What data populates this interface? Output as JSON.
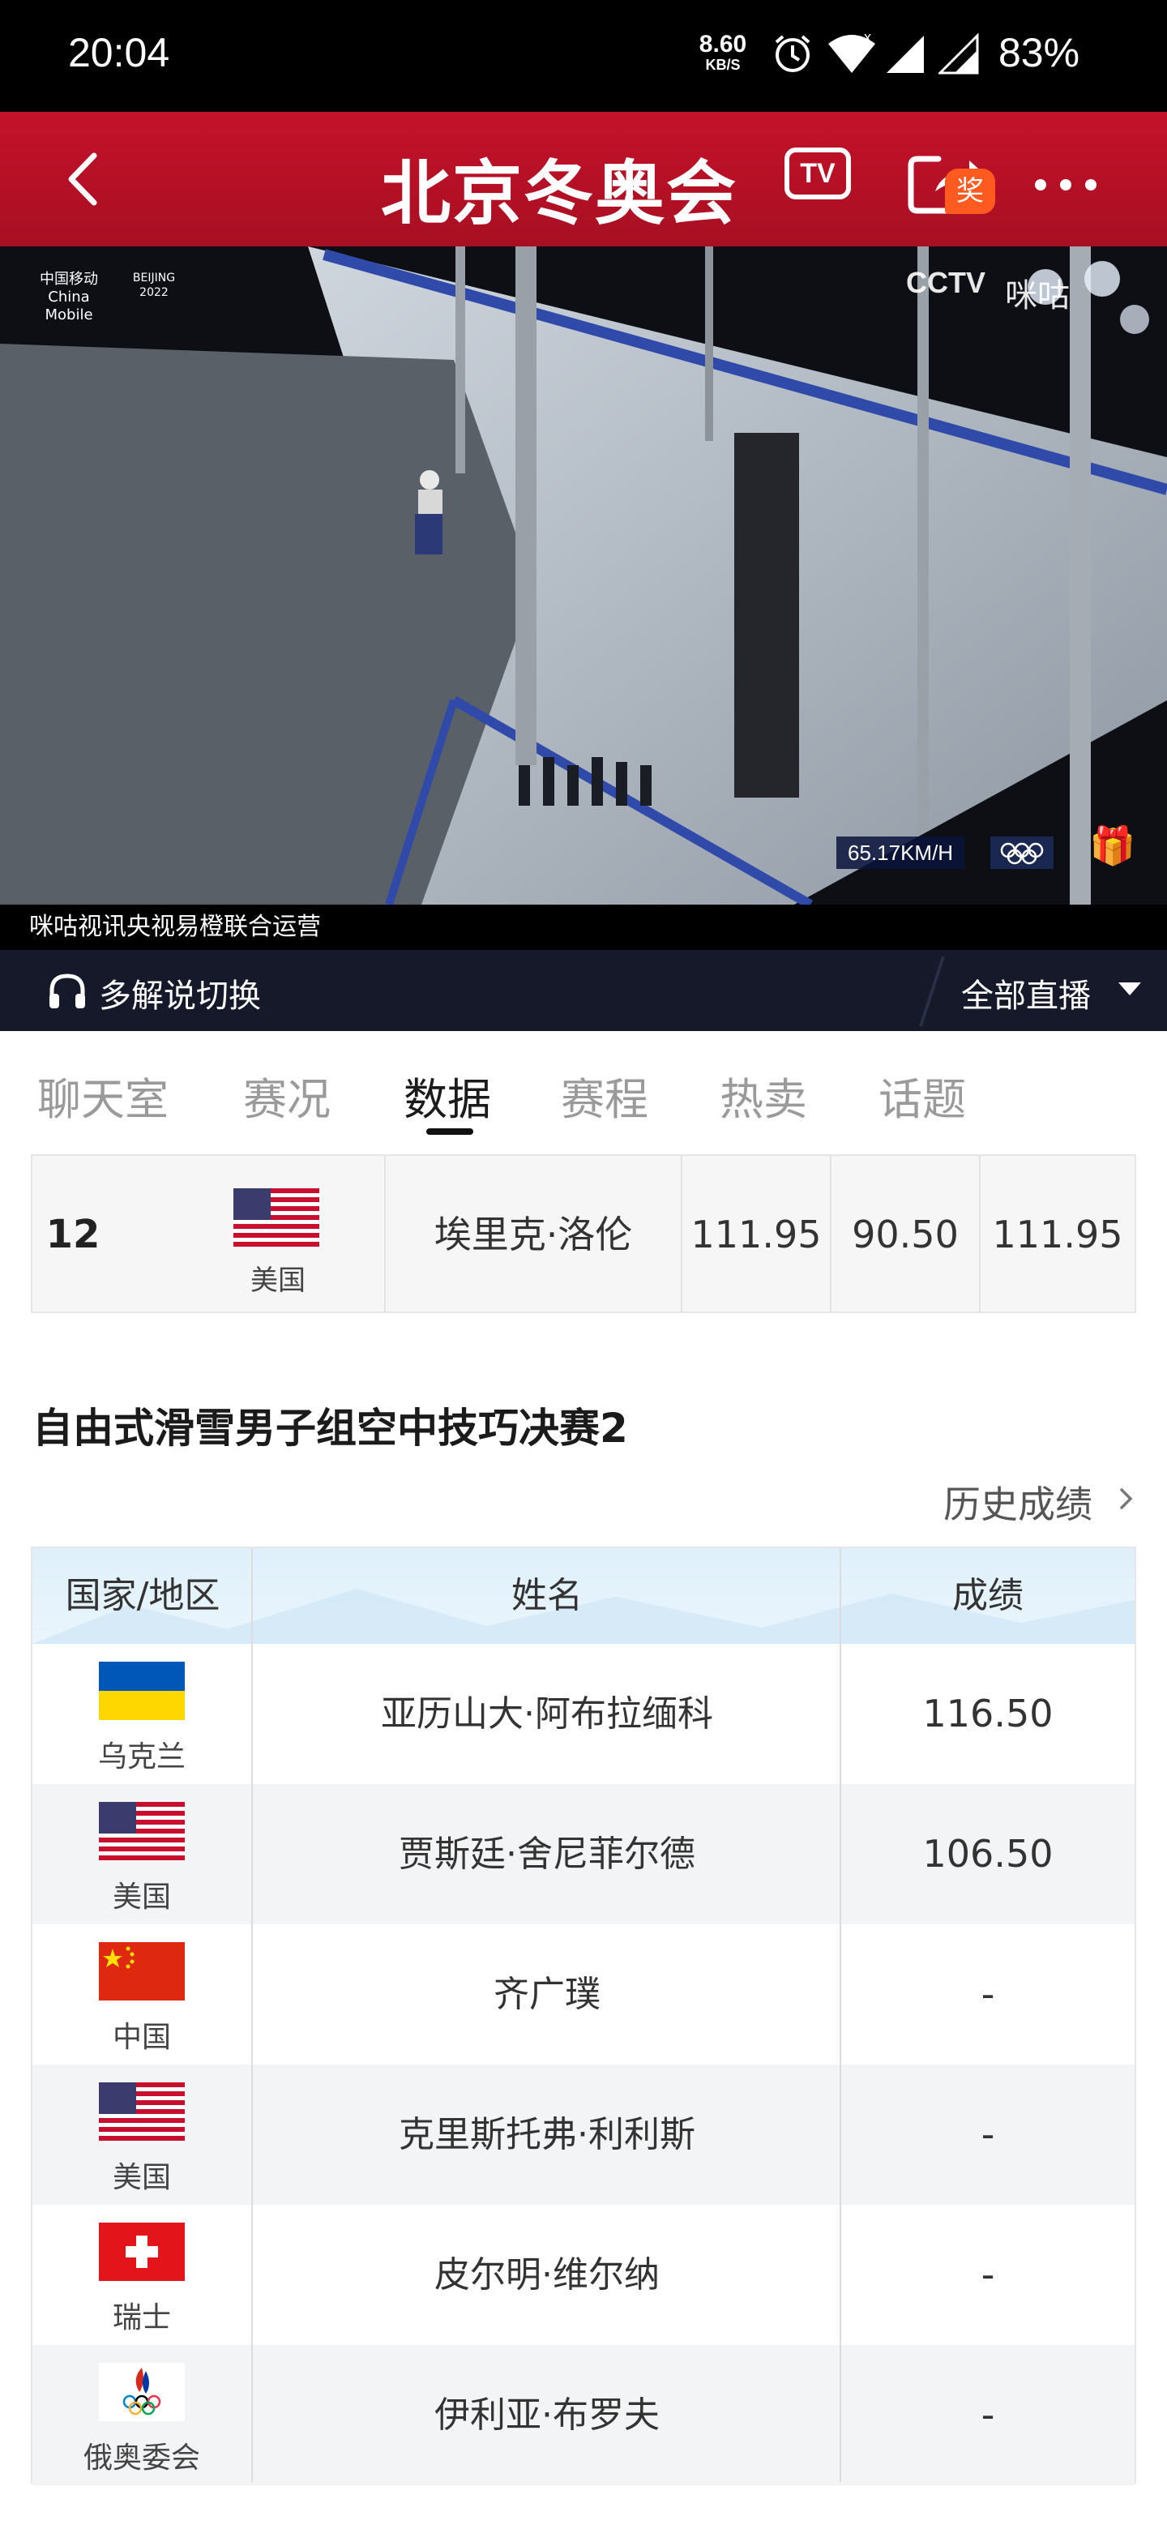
{
  "status_bar": {
    "time": "20:04",
    "net_speed_value": "8.60",
    "net_speed_unit": "KB/S",
    "battery": "83%"
  },
  "topbar": {
    "title": "北京冬奥会",
    "tv_badge": "TV",
    "reward_badge": "奖"
  },
  "video": {
    "caption": "咪咕视讯央视易橙联合运营",
    "speed_readout": "65.17KM/H",
    "broadcaster": "CCTV",
    "overlay_logo": "咪咕",
    "sponsor_logo_line1": "中国移动",
    "sponsor_logo_line2": "China Mobile",
    "games_logo": "BEIJING 2022"
  },
  "commentary_bar": {
    "switch_label": "多解说切换",
    "live_label": "全部直播"
  },
  "tabs": [
    {
      "label": "聊天室",
      "active": false
    },
    {
      "label": "赛况",
      "active": false
    },
    {
      "label": "数据",
      "active": true
    },
    {
      "label": "赛程",
      "active": false
    },
    {
      "label": "热卖",
      "active": false
    },
    {
      "label": "话题",
      "active": false
    }
  ],
  "prev_table_row": {
    "rank": "12",
    "country": "美国",
    "flag": "us-flag",
    "name": "埃里克·洛伦",
    "score1": "111.95",
    "score2": "90.50",
    "score3": "111.95"
  },
  "section": {
    "title": "自由式滑雪男子组空中技巧决赛2",
    "history_link": "历史成绩"
  },
  "results_table": {
    "headers": [
      "国家/地区",
      "姓名",
      "成绩"
    ],
    "rows": [
      {
        "country": "乌克兰",
        "flag": "ukraine-flag",
        "name": "亚历山大·阿布拉缅科",
        "score": "116.50"
      },
      {
        "country": "美国",
        "flag": "us-flag",
        "name": "贾斯廷·舍尼菲尔德",
        "score": "106.50"
      },
      {
        "country": "中国",
        "flag": "china-flag",
        "name": "齐广璞",
        "score": "-"
      },
      {
        "country": "美国",
        "flag": "us-flag",
        "name": "克里斯托弗·利利斯",
        "score": "-"
      },
      {
        "country": "瑞士",
        "flag": "switzerland-flag",
        "name": "皮尔明·维尔纳",
        "score": "-"
      },
      {
        "country": "俄奥委会",
        "flag": "roc-flag",
        "name": "伊利亚·布罗夫",
        "score": "-"
      }
    ]
  },
  "colors": {
    "brand_red": "#c4122a",
    "commentary_bg": "#15192a",
    "table_header_bg": "#dff0fb"
  }
}
